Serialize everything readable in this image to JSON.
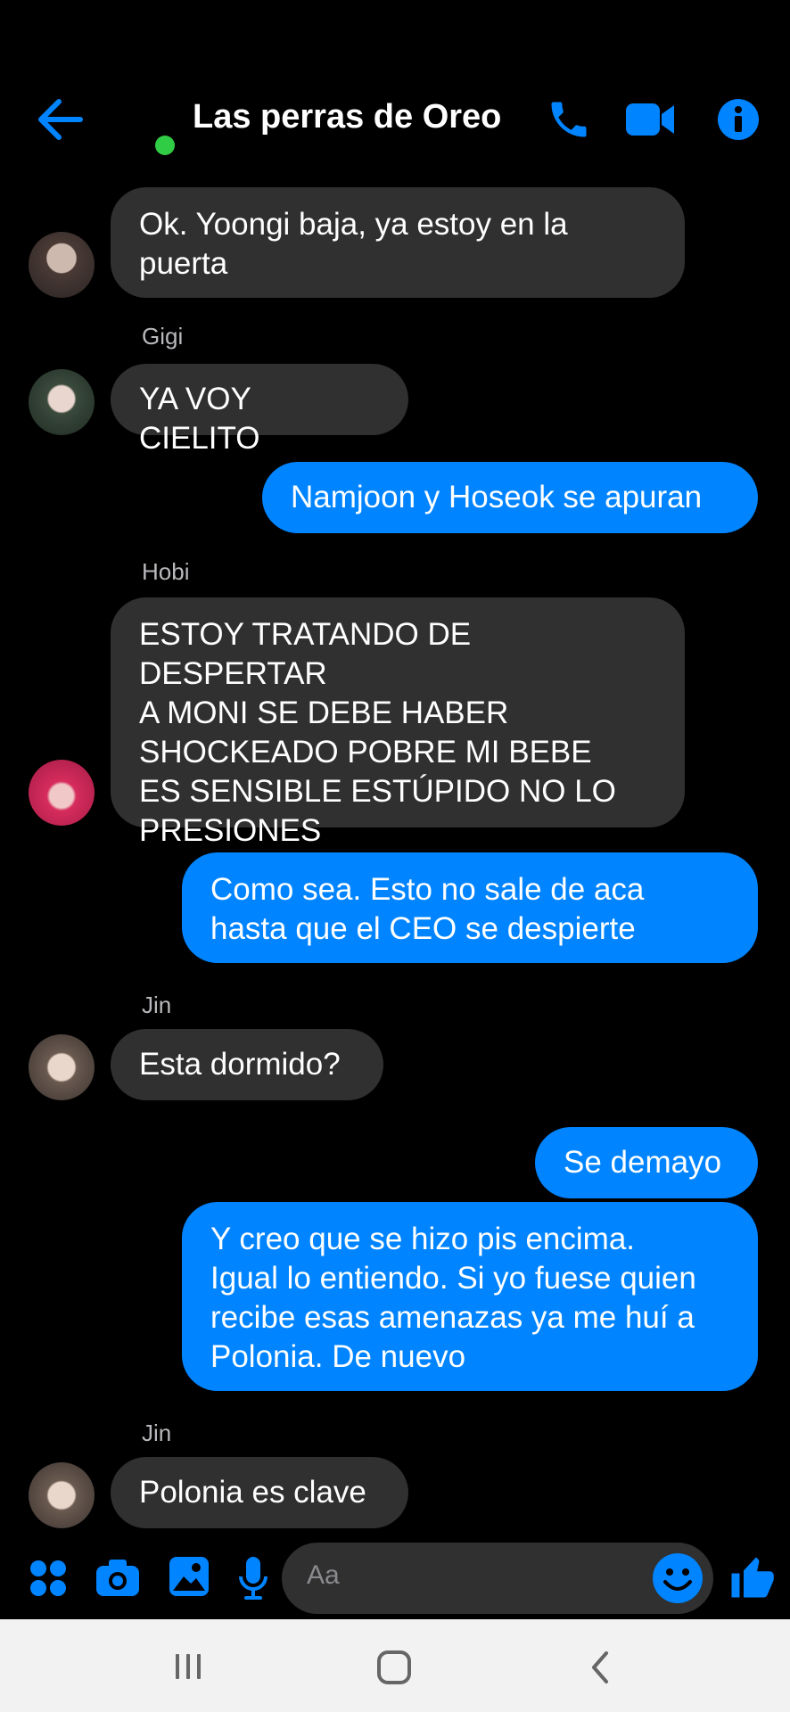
{
  "header": {
    "title": "Las perras de Oreo",
    "online": true,
    "icons": [
      "back-arrow-icon",
      "phone-icon",
      "video-camera-icon",
      "info-icon"
    ]
  },
  "accent_color": "#0084ff",
  "messages": [
    {
      "dir": "in",
      "sender": "",
      "text": "Ok. Yoongi baja, ya estoy en la\npuerta"
    },
    {
      "dir": "in",
      "sender": "Gigi",
      "text": "YA VOY CIELITO"
    },
    {
      "dir": "out",
      "text": "Namjoon y Hoseok se apuran"
    },
    {
      "dir": "in",
      "sender": "Hobi",
      "text": "ESTOY TRATANDO DE DESPERTAR\nA MONI SE DEBE HABER\nSHOCKEADO POBRE MI BEBE\nES SENSIBLE ESTÚPIDO NO LO\nPRESIONES"
    },
    {
      "dir": "out",
      "text": "Como sea. Esto no sale de aca\nhasta que el CEO se despierte"
    },
    {
      "dir": "in",
      "sender": "Jin",
      "text": "Esta dormido?"
    },
    {
      "dir": "out",
      "text": "Se demayo"
    },
    {
      "dir": "out",
      "text": "Y creo que se hizo pis encima.\nIgual lo entiendo. Si yo fuese quien\nrecibe esas amenazas ya me huí a\nPolonia. De nuevo"
    },
    {
      "dir": "in",
      "sender": "Jin",
      "text": "Polonia es clave"
    }
  ],
  "composer": {
    "placeholder": "Aa",
    "icons": [
      "apps-grid-icon",
      "camera-icon",
      "gallery-icon",
      "microphone-icon",
      "emoji-icon",
      "thumbs-up-icon"
    ]
  },
  "navbar": {
    "icons": [
      "recent-apps-icon",
      "home-icon",
      "back-icon"
    ]
  }
}
